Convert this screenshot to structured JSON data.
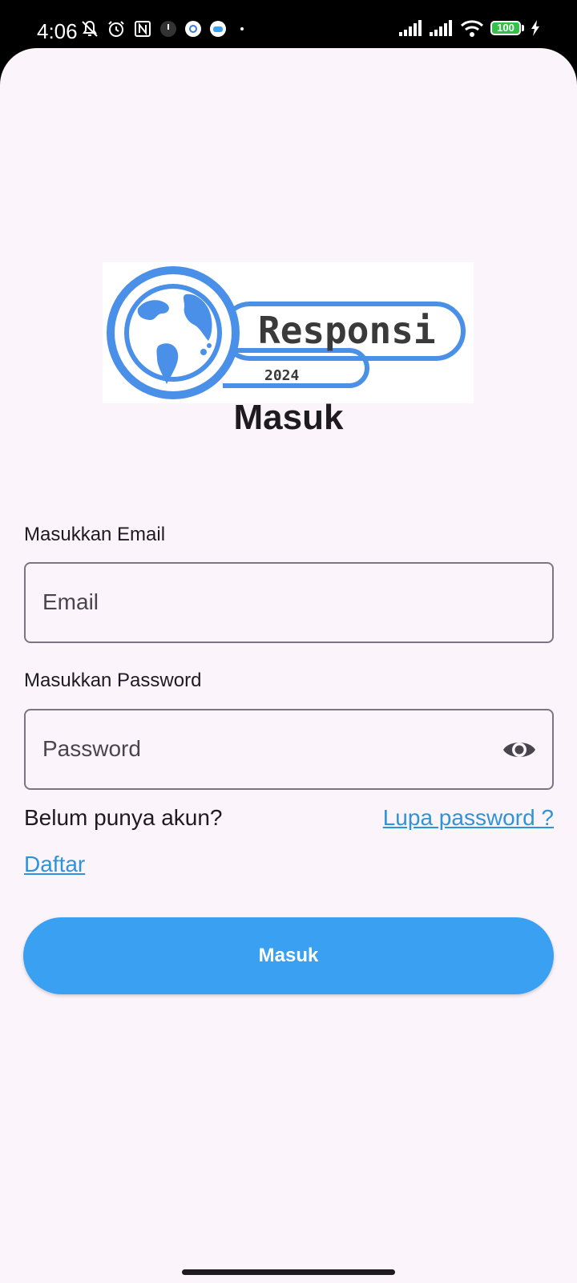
{
  "status_bar": {
    "time": "4:06",
    "battery": "100",
    "icons": [
      "bell-off-icon",
      "alarm-icon",
      "nfc-icon",
      "dark-app-icon",
      "settings-app-icon",
      "game-app-icon",
      "dot-icon",
      "signal-icon",
      "signal-icon",
      "wifi-icon",
      "battery-icon",
      "charging-icon"
    ]
  },
  "logo": {
    "brand": "Responsi",
    "year": "2024"
  },
  "form": {
    "title": "Masuk",
    "email_label": "Masukkan Email",
    "email_placeholder": "Email",
    "password_label": "Masukkan Password",
    "password_placeholder": "Password",
    "password_toggle_icon": "eye-icon",
    "signup_prompt": "Belum punya akun?",
    "forgot_password": "Lupa password ?",
    "register": "Daftar",
    "submit": "Masuk"
  },
  "colors": {
    "background": "#fcf4fb",
    "accent": "#3aa0f1",
    "link": "#2e93d8",
    "logo_blue": "#4a8fe8"
  }
}
